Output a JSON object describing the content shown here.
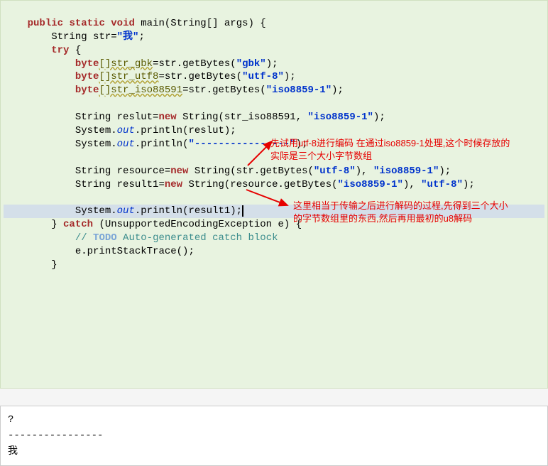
{
  "code": {
    "l1_kw_public": "public",
    "l1_kw_static": "static",
    "l1_kw_void": "void",
    "l1_main": "main(String[] args) {",
    "l2_str": "String str=",
    "l2_lit": "\"我\"",
    "l2_semi": ";",
    "l3_try": "try",
    "l3_brace": " {",
    "l4_byte": "byte",
    "l4_var": "[]str_gbk",
    "l4_expr": "=str.getBytes(",
    "l4_lit": "\"gbk\"",
    "l4_end": ");",
    "l5_byte": "byte",
    "l5_var": "[]str_utf8",
    "l5_expr": "=str.getBytes(",
    "l5_lit": "\"utf-8\"",
    "l5_end": ");",
    "l6_byte": "byte",
    "l6_var": "[]str_iso88591",
    "l6_expr": "=str.getBytes(",
    "l6_lit": "\"iso8859-1\"",
    "l6_end": ");",
    "l7_blank": "",
    "l8_a": "String reslut=",
    "l8_new": "new",
    "l8_b": " String(str_iso88591, ",
    "l8_lit": "\"iso8859-1\"",
    "l8_end": ");",
    "l9_a": "System.",
    "l9_out": "out",
    "l9_b": ".println(reslut);",
    "l10_a": "System.",
    "l10_out": "out",
    "l10_b": ".println(",
    "l10_lit": "\"----------------\"",
    "l10_end": ");",
    "l11_blank": "",
    "l12_a": "String resource=",
    "l12_new": "new",
    "l12_b": " String(str.getBytes(",
    "l12_lit1": "\"utf-8\"",
    "l12_c": "), ",
    "l12_lit2": "\"iso8859-1\"",
    "l12_end": ");",
    "l13_a": "String result1=",
    "l13_new": "new",
    "l13_b": " String(resource.getBytes(",
    "l13_lit1": "\"iso8859-1\"",
    "l13_c": "), ",
    "l13_lit2": "\"utf-8\"",
    "l13_end": ");",
    "l14_blank": "",
    "l15_a": "System.",
    "l15_out": "out",
    "l15_b": ".println(result1);",
    "l16_catch_a": "} ",
    "l16_kw_catch": "catch",
    "l16_catch_b": " (UnsupportedEncodingException e) {",
    "l17_todo_kw": "TODO",
    "l17_todo_rest": " Auto-generated catch block",
    "l17_prefix": "// ",
    "l18": "e.printStackTrace();",
    "l19": "}"
  },
  "annotations": {
    "a1": "先试用utf-8进行编码 在通过iso8859-1处理,这个时候存放的实际是三个大小字节数组",
    "a2": "这里相当于传输之后进行解码的过程,先得到三个大小的字节数组里的东西,然后再用最初的u8解码"
  },
  "output": {
    "line1": "?",
    "line2": "----------------",
    "line3": "我"
  }
}
